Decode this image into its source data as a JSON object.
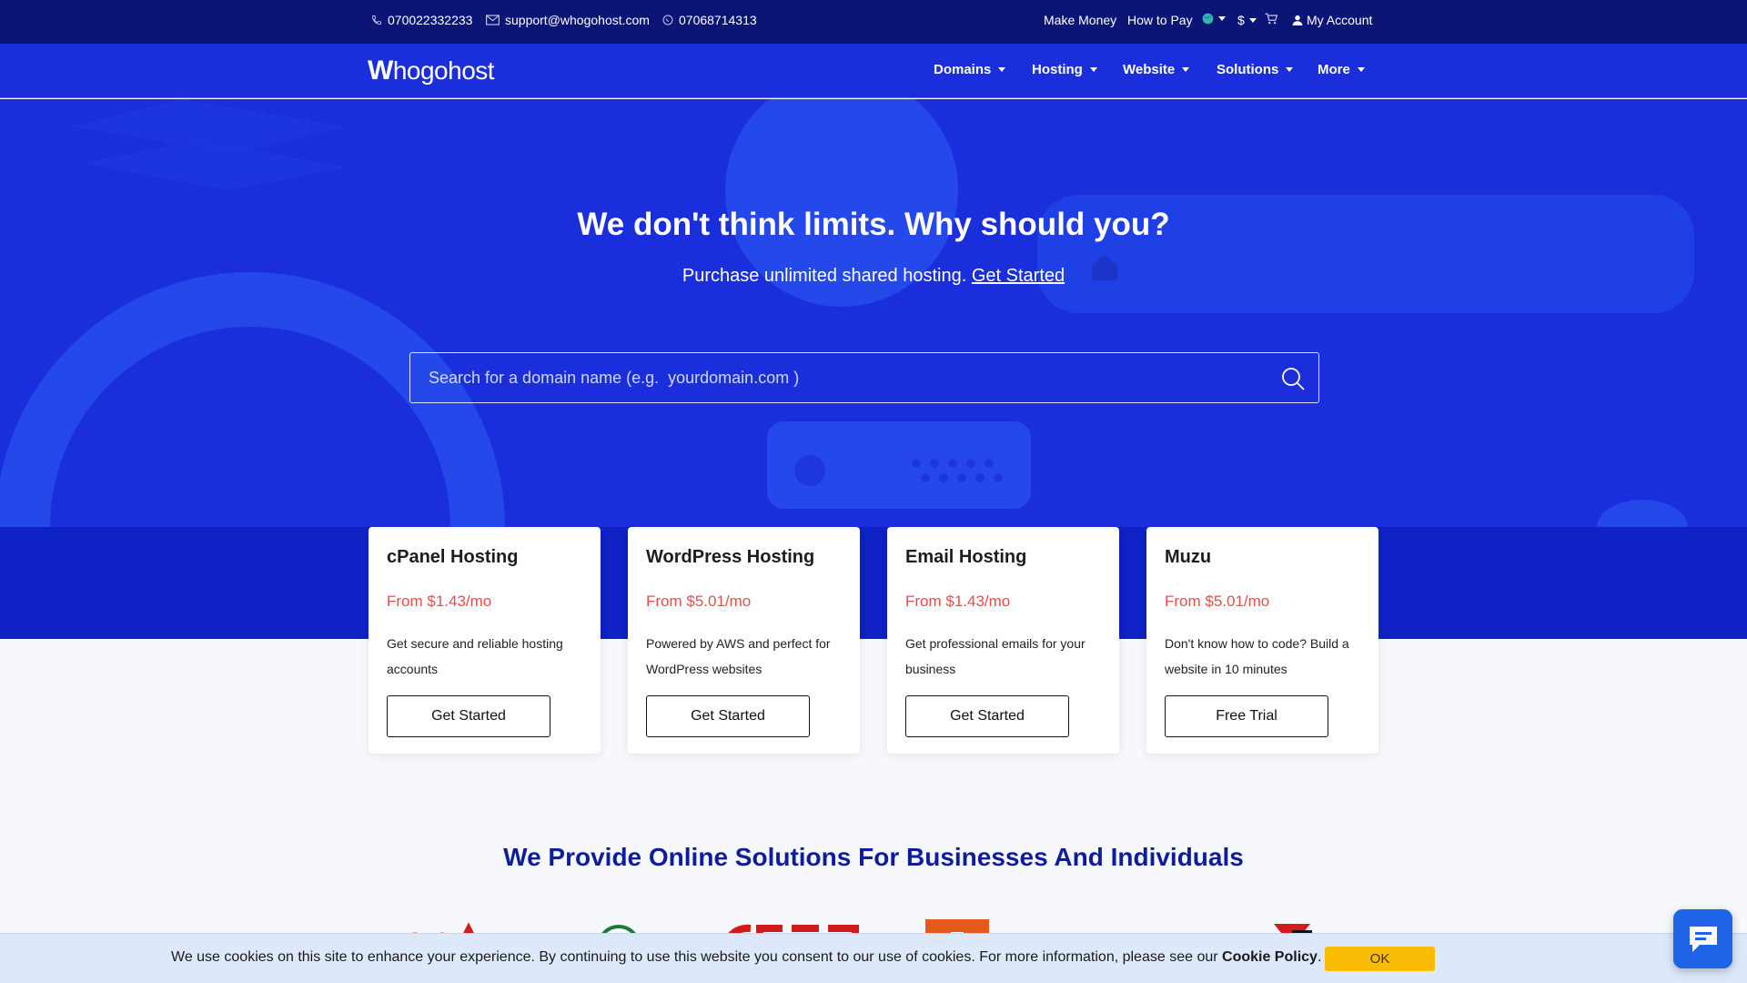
{
  "topbar": {
    "phone1": "070022332233",
    "email": "support@whogohost.com",
    "phone2": "07068714313",
    "make_money": "Make Money",
    "how_to_pay": "How to Pay",
    "currency": "$",
    "my_account": "My Account"
  },
  "nav": {
    "logo_text": "hogohost",
    "logo_mark": "W",
    "items": [
      "Domains",
      "Hosting",
      "Website",
      "Solutions",
      "More"
    ]
  },
  "hero": {
    "title": "We don't think limits. Why should you?",
    "subtitle": "Purchase unlimited shared hosting.",
    "subtitle_link": "Get Started",
    "search_placeholder": "Search for a domain name (e.g.  yourdomain.com )"
  },
  "cards": [
    {
      "title": "cPanel Hosting",
      "price": "From $1.43/mo",
      "desc": "Get secure and reliable hosting accounts",
      "button": "Get Started"
    },
    {
      "title": "WordPress Hosting",
      "price": "From $5.01/mo",
      "desc": "Powered by AWS and perfect for WordPress websites",
      "button": "Get Started"
    },
    {
      "title": "Email Hosting",
      "price": "From $1.43/mo",
      "desc": "Get professional emails for your business",
      "button": "Get Started"
    },
    {
      "title": "Muzu",
      "price": "From $5.01/mo",
      "desc": "Don't know how to code? Build a website in 10 minutes",
      "button": "Free Trial"
    }
  ],
  "section": {
    "title": "We Provide Online Solutions For Businesses And Individuals"
  },
  "cookie": {
    "text": "We use cookies on this site to enhance your experience. By continuing to use this website you consent to our use of cookies. For more information, please see our",
    "policy_link": "Cookie Policy",
    "ok": "OK"
  },
  "colors": {
    "topbar_bg": "#0b1575",
    "hero_bg": "#1a2fdb",
    "price": "#ef4a4a",
    "section_title": "#0e1d9e",
    "cookie_ok": "#fbbc05",
    "chat": "#1e64e6"
  },
  "icons": {
    "phone": "phone-icon",
    "email": "envelope-icon",
    "whatsapp": "whatsapp-icon",
    "language": "globe-icon",
    "cart": "cart-icon",
    "account": "user-icon",
    "search": "search-icon",
    "chat": "chat-icon"
  }
}
